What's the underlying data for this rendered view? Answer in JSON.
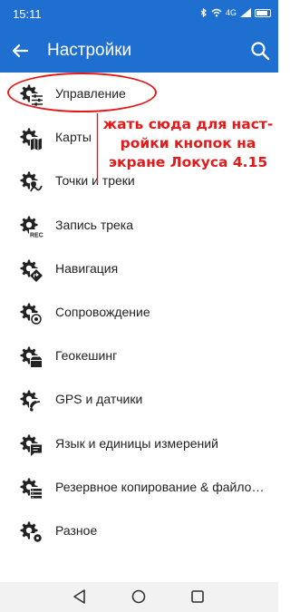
{
  "status": {
    "time": "15:11",
    "network": "4G",
    "battery_level": 1
  },
  "app_bar": {
    "title": "Настройки"
  },
  "items": [
    {
      "label": "Управление",
      "icon": "gear-sliders-icon"
    },
    {
      "label": "Карты",
      "icon": "gear-map-icon"
    },
    {
      "label": "Точки и треки",
      "icon": "gear-points-tracks-icon"
    },
    {
      "label": "Запись трека",
      "icon": "gear-rec-icon"
    },
    {
      "label": "Навигация",
      "icon": "gear-navigation-icon"
    },
    {
      "label": "Сопровождение",
      "icon": "gear-guidance-icon"
    },
    {
      "label": "Геокешинг",
      "icon": "gear-geocache-icon"
    },
    {
      "label": "GPS и датчики",
      "icon": "gear-gps-icon"
    },
    {
      "label": "Язык и единицы измерений",
      "icon": "gear-language-icon"
    },
    {
      "label": "Резервное копирование & файло…",
      "icon": "gear-backup-icon"
    },
    {
      "label": "Разное",
      "icon": "gear-misc-icon"
    }
  ],
  "annotation": {
    "text": "жать сюда для наст-ройки кнопок на экране Локуса 4.15",
    "color": "#e31a1a"
  },
  "colors": {
    "accent": "#1e6fd0",
    "annotation": "#e31a1a"
  }
}
